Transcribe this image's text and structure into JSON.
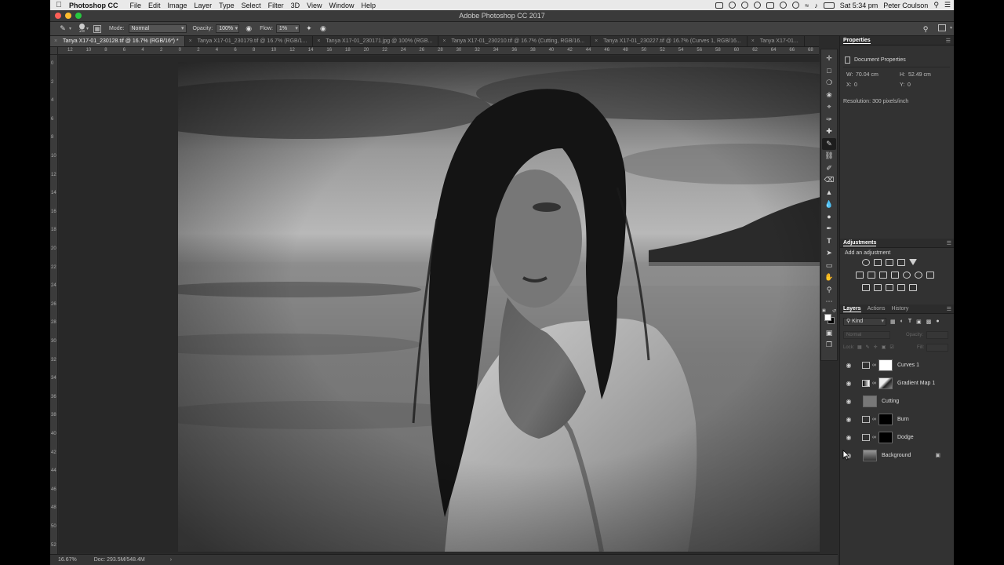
{
  "menubar": {
    "app_name": "Photoshop CC",
    "items": [
      "File",
      "Edit",
      "Image",
      "Layer",
      "Type",
      "Select",
      "Filter",
      "3D",
      "View",
      "Window",
      "Help"
    ],
    "clock": "Sat 5:34 pm",
    "user": "Peter Coulson"
  },
  "window": {
    "title": "Adobe Photoshop CC 2017"
  },
  "options": {
    "brush_size": "25",
    "mode_label": "Mode:",
    "mode_value": "Normal",
    "opacity_label": "Opacity:",
    "opacity_value": "100%",
    "flow_label": "Flow:",
    "flow_value": "1%"
  },
  "tabs": [
    {
      "label": "Tanya X17-01_230128.tif @ 16.7% (RGB/16*) *",
      "active": true
    },
    {
      "label": "Tanya X17-01_230179.tif @ 16.7% (RGB/1...",
      "active": false
    },
    {
      "label": "Tanya X17-01_230171.jpg @ 100% (RGB...",
      "active": false
    },
    {
      "label": "Tanya X17-01_230210.tif @ 16.7% (Cutting, RGB/16...",
      "active": false
    },
    {
      "label": "Tanya X17-01_230227.tif @ 16.7% (Curves 1, RGB/16...",
      "active": false
    },
    {
      "label": "Tanya X17-01...",
      "active": false
    }
  ],
  "ruler": {
    "top_ticks": [
      "12",
      "10",
      "8",
      "6",
      "4",
      "2",
      "0",
      "2",
      "4",
      "6",
      "8",
      "10",
      "12",
      "14",
      "16",
      "18",
      "20",
      "22",
      "24",
      "26",
      "28",
      "30",
      "32",
      "34",
      "36",
      "38",
      "40",
      "42",
      "44",
      "46",
      "48",
      "50",
      "52",
      "54",
      "56",
      "58",
      "60",
      "62",
      "64",
      "66",
      "68"
    ],
    "left_ticks": [
      "0",
      "2",
      "4",
      "6",
      "8",
      "10",
      "12",
      "14",
      "16",
      "18",
      "20",
      "22",
      "24",
      "26",
      "28",
      "30",
      "32",
      "34",
      "36",
      "38",
      "40",
      "42",
      "44",
      "46",
      "48",
      "50",
      "52"
    ]
  },
  "statusbar": {
    "zoom": "16.67%",
    "doc": "Doc: 293.5M/548.4M"
  },
  "properties": {
    "tab": "Properties",
    "section": "Document Properties",
    "w_label": "W:",
    "w_value": "70.04 cm",
    "h_label": "H:",
    "h_value": "52.49 cm",
    "x_label": "X:",
    "x_value": "0",
    "y_label": "Y:",
    "y_value": "0",
    "resolution": "Resolution: 300 pixels/inch"
  },
  "adjustments": {
    "tab": "Adjustments",
    "subtitle": "Add an adjustment"
  },
  "layers_panel": {
    "tabs": [
      "Layers",
      "Actions",
      "History"
    ],
    "kind_label": "Kind",
    "blend_placeholder": "Normal",
    "opacity_label": "Opacity:",
    "lock_label": "Lock:",
    "fill_label": "Fill:",
    "layers": [
      {
        "name": "Curves 1",
        "type": "adjustment",
        "mask": "white"
      },
      {
        "name": "Gradient Map 1",
        "type": "adjustment",
        "mask": "photo"
      },
      {
        "name": "Cutting",
        "type": "pixel",
        "mask": "none"
      },
      {
        "name": "Burn",
        "type": "adjustment",
        "mask": "black"
      },
      {
        "name": "Dodge",
        "type": "adjustment",
        "mask": "black"
      },
      {
        "name": "Background",
        "type": "background",
        "mask": "none"
      }
    ]
  },
  "colors": {
    "ui_bg": "#2b2b2b",
    "panel_bg": "#323232",
    "menubar_bg": "#e9e9e9"
  }
}
